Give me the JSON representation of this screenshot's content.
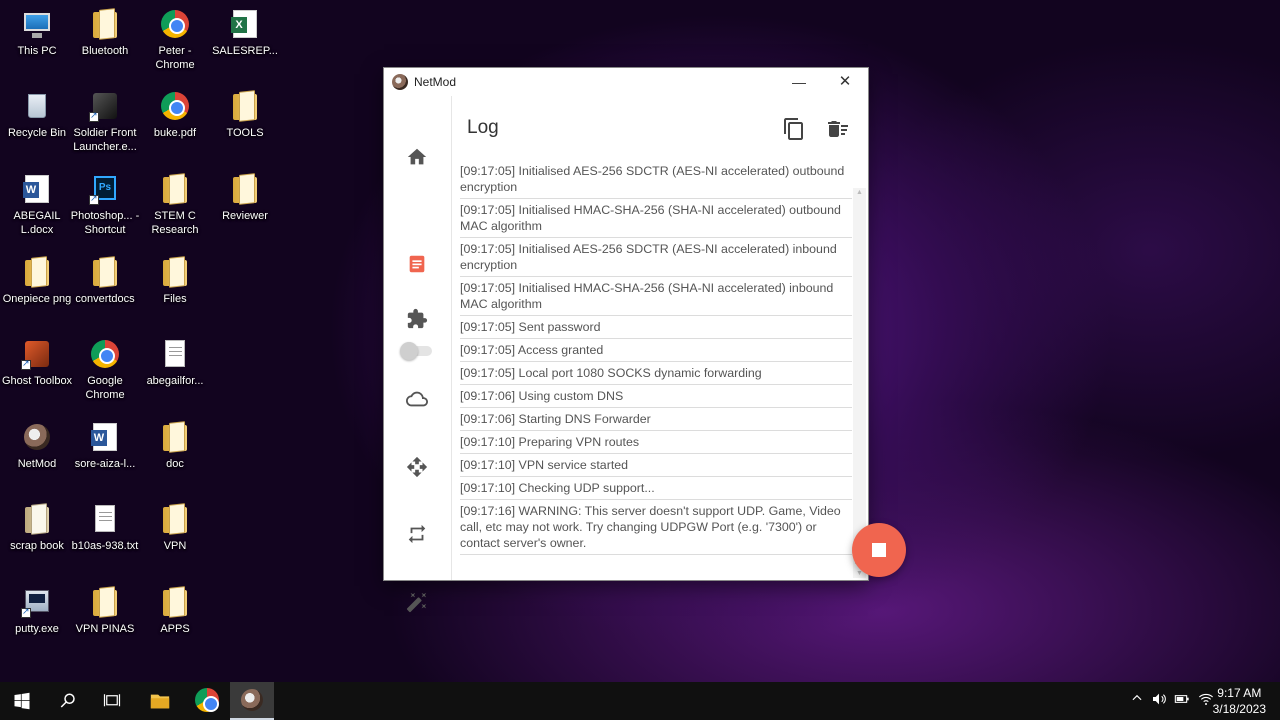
{
  "desktop": {
    "icons": [
      {
        "label": "This PC"
      },
      {
        "label": "Bluetooth"
      },
      {
        "label": "Peter - Chrome"
      },
      {
        "label": "SALESREP..."
      },
      {
        "label": "Recycle Bin"
      },
      {
        "label": "Soldier Front Launcher.e..."
      },
      {
        "label": "buke.pdf"
      },
      {
        "label": "TOOLS"
      },
      {
        "label": "ABEGAIL L.docx"
      },
      {
        "label": "Photoshop... - Shortcut"
      },
      {
        "label": "STEM C Research"
      },
      {
        "label": "Reviewer"
      },
      {
        "label": "Onepiece png"
      },
      {
        "label": "convertdocs"
      },
      {
        "label": "Files"
      },
      {
        "label": "Ghost Toolbox"
      },
      {
        "label": "Google Chrome"
      },
      {
        "label": "abegailfor..."
      },
      {
        "label": "NetMod"
      },
      {
        "label": "sore-aiza-l..."
      },
      {
        "label": "doc"
      },
      {
        "label": "scrap book"
      },
      {
        "label": "b10as-938.txt"
      },
      {
        "label": "VPN"
      },
      {
        "label": "putty.exe"
      },
      {
        "label": "VPN PINAS"
      },
      {
        "label": "APPS"
      }
    ]
  },
  "window": {
    "title": "NetMod",
    "minimize": "—",
    "close": "✕",
    "page_title": "Log",
    "accent_color": "#f0654f",
    "log_entries": [
      "[09:17:05] Initialised AES-256 SDCTR (AES-NI accelerated) outbound encryption",
      "[09:17:05] Initialised HMAC-SHA-256 (SHA-NI accelerated) outbound MAC algorithm",
      "[09:17:05] Initialised AES-256 SDCTR (AES-NI accelerated) inbound encryption",
      "[09:17:05] Initialised HMAC-SHA-256 (SHA-NI accelerated) inbound MAC algorithm",
      "[09:17:05] Sent password",
      "[09:17:05] Access granted",
      "[09:17:05] Local port 1080 SOCKS dynamic forwarding",
      "[09:17:06] Using custom DNS",
      "[09:17:06] Starting DNS Forwarder",
      "[09:17:10] Preparing VPN routes",
      "[09:17:10] VPN service started",
      "[09:17:10] Checking UDP support...",
      "[09:17:16] WARNING: This server doesn't support UDP. Game, Video call, etc may not work. Try changing UDPGW Port (e.g. '7300') or contact server's owner."
    ]
  },
  "taskbar": {
    "time": "9:17 AM",
    "date": "3/18/2023"
  }
}
